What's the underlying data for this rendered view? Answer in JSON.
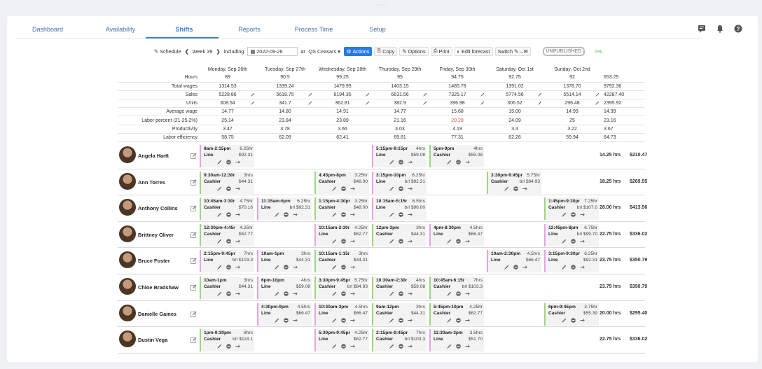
{
  "nav": {
    "tabs": [
      {
        "label": "Dashboard"
      },
      {
        "label": "Availability"
      },
      {
        "label": "Shifts"
      },
      {
        "label": "Reports"
      },
      {
        "label": "Process Time"
      },
      {
        "label": "Setup"
      }
    ],
    "active": "Shifts",
    "icons": [
      "chat-icon",
      "bell-icon",
      "help-icon"
    ]
  },
  "toolbar": {
    "schedule": "Schedule",
    "week": "Week 39",
    "including": "including",
    "date": "2022-09-26",
    "at": "at",
    "location": "QS Ceasars",
    "actions": "Actions",
    "copy": "Copy",
    "options": "Options",
    "print": "Print",
    "edit_forecast": "Edit forecast",
    "switch": "Switch",
    "status": "UNPUBLISHED",
    "percent": "0%"
  },
  "stats": {
    "days": [
      "Monday, Sep 26th",
      "Tuesday, Sep 27th",
      "Wednesday, Sep 28th",
      "Thursday, Sep 29th",
      "Friday, Sep 30th",
      "Saturday, Oct 1st",
      "Sunday, Oct 2nd"
    ],
    "rows": [
      {
        "label": "Hours",
        "values": [
          "89",
          "90.5",
          "99.25",
          "95",
          "94.75",
          "92.75",
          "92"
        ],
        "total": "653.25"
      },
      {
        "label": "Total wages",
        "values": [
          "1314.53",
          "1339.24",
          "1479.95",
          "1403.15",
          "1485.78",
          "1391.02",
          "1378.70"
        ],
        "total": "9792.36"
      },
      {
        "label": "Sales",
        "values": [
          "5228.86",
          "5618.75",
          "6194.35",
          "6631.56",
          "7325.17",
          "5774.56",
          "5514.14"
        ],
        "total": "42287.40",
        "editable": true
      },
      {
        "label": "Units",
        "values": [
          "308.54",
          "341.7",
          "362.81",
          "382.9",
          "396.98",
          "306.52",
          "296.48"
        ],
        "total": "2395.92",
        "editable": true
      },
      {
        "label": "Average wage",
        "values": [
          "14.77",
          "14.80",
          "14.91",
          "14.77",
          "15.68",
          "15.00",
          "14.99"
        ],
        "total": "14.99"
      },
      {
        "label": "Labor percent (21-25.2%)",
        "values": [
          "25.14",
          "23.84",
          "23.89",
          "21.16",
          "20.28",
          "24.09",
          "25"
        ],
        "total": "23.16",
        "red_index": 4
      },
      {
        "label": "Productivity",
        "values": [
          "3.47",
          "3.78",
          "3.66",
          "4.03",
          "4.19",
          "3.3",
          "3.22"
        ],
        "total": "3.67"
      },
      {
        "label": "Labor efficiency",
        "values": [
          "58.75",
          "62.09",
          "62.41",
          "69.81",
          "77.31",
          "62.26",
          "59.94"
        ],
        "total": "64.73"
      }
    ]
  },
  "employees": [
    {
      "name": "Angela Hartt",
      "hours": "14.25 hrs",
      "pay": "$210.47",
      "shifts": [
        {
          "day": 0,
          "time": "8am-2:15pm",
          "dur": "6.25hr",
          "role": "Line",
          "pay": "$92.31",
          "color": "pink"
        },
        {
          "day": 3,
          "time": "5:15pm-9:15pr",
          "dur": "4hrs",
          "role": "Line",
          "pay": "$59.08",
          "color": "pink"
        },
        {
          "day": 4,
          "time": "5pm-9pm",
          "dur": "4hrs",
          "role": "Cashier",
          "pay": "$59.08",
          "color": "green"
        }
      ]
    },
    {
      "name": "Ann Torres",
      "hours": "18.25 hrs",
      "pay": "$269.55",
      "shifts": [
        {
          "day": 0,
          "time": "9:30am-12:30r",
          "dur": "3hrs",
          "role": "Cashier",
          "pay": "$44.31",
          "color": "green"
        },
        {
          "day": 2,
          "time": "4:45pm-8pm",
          "dur": "3.25hr",
          "role": "Cashier",
          "pay": "$48.00",
          "color": "green"
        },
        {
          "day": 3,
          "time": "3:15pm-10pm",
          "dur": "6.25hr",
          "role": "Line",
          "pay": "brl $92.31",
          "color": "pink"
        },
        {
          "day": 5,
          "time": "3:30pm-9:45pr",
          "dur": "5.75hr",
          "role": "Cashier",
          "pay": "brl $84.93",
          "color": "green"
        }
      ]
    },
    {
      "name": "Anthony Collins",
      "hours": "28.00 hrs",
      "pay": "$413.56",
      "shifts": [
        {
          "day": 0,
          "time": "10:45am-3:30r",
          "dur": "4.75hr",
          "role": "Cashier",
          "pay": "$70.16",
          "color": "green"
        },
        {
          "day": 1,
          "time": "11:15am-6pm",
          "dur": "6.25hr",
          "role": "Line",
          "pay": "brl $92.31",
          "color": "pink"
        },
        {
          "day": 2,
          "time": "1:15pm-4:30pr",
          "dur": "3.25hr",
          "role": "Cashier",
          "pay": "$48.00",
          "color": "green"
        },
        {
          "day": 3,
          "time": "10:15am-5:15r",
          "dur": "6.5hrs",
          "role": "Line",
          "pay": "brl $96.00",
          "color": "pink"
        },
        {
          "day": 6,
          "time": "1:45pm-9:30pr",
          "dur": "7.25hr",
          "role": "Cashier",
          "pay": "brl $107.0",
          "color": "green"
        }
      ]
    },
    {
      "name": "Brittney Oliver",
      "hours": "22.75 hrs",
      "pay": "$336.02",
      "shifts": [
        {
          "day": 0,
          "time": "12:30pm-4:45r",
          "dur": "4.25hr",
          "role": "Cashier",
          "pay": "$62.77",
          "color": "green"
        },
        {
          "day": 2,
          "time": "10:15am-2:30r",
          "dur": "4.25hr",
          "role": "Line",
          "pay": "$62.77",
          "color": "pink"
        },
        {
          "day": 3,
          "time": "12pm-3pm",
          "dur": "3hrs",
          "role": "Cashier",
          "pay": "$44.31",
          "color": "green"
        },
        {
          "day": 4,
          "time": "4pm-8:30pm",
          "dur": "4.5hrs",
          "role": "Line",
          "pay": "$66.47",
          "color": "pink"
        },
        {
          "day": 6,
          "time": "12:45pm-8pm",
          "dur": "6.75hr",
          "role": "Line",
          "pay": "brl $99.70",
          "color": "pink"
        }
      ]
    },
    {
      "name": "Bruce Foster",
      "hours": "23.75 hrs",
      "pay": "$350.79",
      "shifts": [
        {
          "day": 0,
          "time": "2:15pm-9:45pr",
          "dur": "7hrs",
          "role": "Line",
          "pay": "brl $103.3",
          "color": "pink"
        },
        {
          "day": 1,
          "time": "10am-1pm",
          "dur": "3hrs",
          "role": "Line",
          "pay": "$44.31",
          "color": "pink"
        },
        {
          "day": 2,
          "time": "10:15am-1:15r",
          "dur": "3hrs",
          "role": "Cashier",
          "pay": "$44.31",
          "color": "green"
        },
        {
          "day": 5,
          "time": "10am-2:30pm",
          "dur": "4.5hrs",
          "role": "Line",
          "pay": "$66.47",
          "color": "pink"
        },
        {
          "day": 6,
          "time": "3:15pm-9:30pr",
          "dur": "6.25hr",
          "role": "Line",
          "pay": "$92.31",
          "color": "pink"
        }
      ]
    },
    {
      "name": "Chloe Bradshaw",
      "hours": "23.75 hrs",
      "pay": "$350.79",
      "shifts": [
        {
          "day": 0,
          "time": "10am-1pm",
          "dur": "3hrs",
          "role": "Cashier",
          "pay": "$44.31",
          "color": "green"
        },
        {
          "day": 1,
          "time": "6pm-10pm",
          "dur": "4hrs",
          "role": "Line",
          "pay": "$59.08",
          "color": "pink"
        },
        {
          "day": 2,
          "time": "3:30pm-9:45pr",
          "dur": "5.75hr",
          "role": "Cashier",
          "pay": "brl $84.93",
          "color": "green"
        },
        {
          "day": 3,
          "time": "10:30am-2:30r",
          "dur": "4hrs",
          "role": "Cashier",
          "pay": "$59.08",
          "color": "green"
        },
        {
          "day": 4,
          "time": "10:45am-6:15r",
          "dur": "7hrs",
          "role": "Cashier",
          "pay": "brl $103.3",
          "color": "green"
        }
      ]
    },
    {
      "name": "Danielle Gaines",
      "hours": "20.00 hrs",
      "pay": "$295.40",
      "shifts": [
        {
          "day": 1,
          "time": "4:30pm-9pm",
          "dur": "4.5hrs",
          "role": "Line",
          "pay": "$66.47",
          "color": "pink"
        },
        {
          "day": 2,
          "time": "10:30am-3pm",
          "dur": "4.5hrs",
          "role": "Line",
          "pay": "$66.47",
          "color": "pink"
        },
        {
          "day": 3,
          "time": "9am-12pm",
          "dur": "3hrs",
          "role": "Cashier",
          "pay": "$44.31",
          "color": "green"
        },
        {
          "day": 4,
          "time": "5:45pm-10pm",
          "dur": "4.25hr",
          "role": "Cashier",
          "pay": "$62.77",
          "color": "green"
        },
        {
          "day": 6,
          "time": "6pm-9:45pm",
          "dur": "3.75hr",
          "role": "Cashier",
          "pay": "$55.39",
          "color": "green"
        }
      ]
    },
    {
      "name": "Dustin Vega",
      "hours": "22.75 hrs",
      "pay": "$336.02",
      "shifts": [
        {
          "day": 0,
          "time": "1pm-9:30pm",
          "dur": "8hrs",
          "role": "Cashier",
          "pay": "brl $118.1",
          "color": "green"
        },
        {
          "day": 2,
          "time": "5:30pm-9:45pr",
          "dur": "4.25hr",
          "role": "Line",
          "pay": "$62.77",
          "color": "pink"
        },
        {
          "day": 3,
          "time": "2:15pm-9:45pr",
          "dur": "7hrs",
          "role": "Cashier",
          "pay": "brl $103.3",
          "color": "green"
        },
        {
          "day": 4,
          "time": "11:30am-3pm",
          "dur": "3.5hrs",
          "role": "Line",
          "pay": "$51.70",
          "color": "pink"
        }
      ]
    }
  ]
}
